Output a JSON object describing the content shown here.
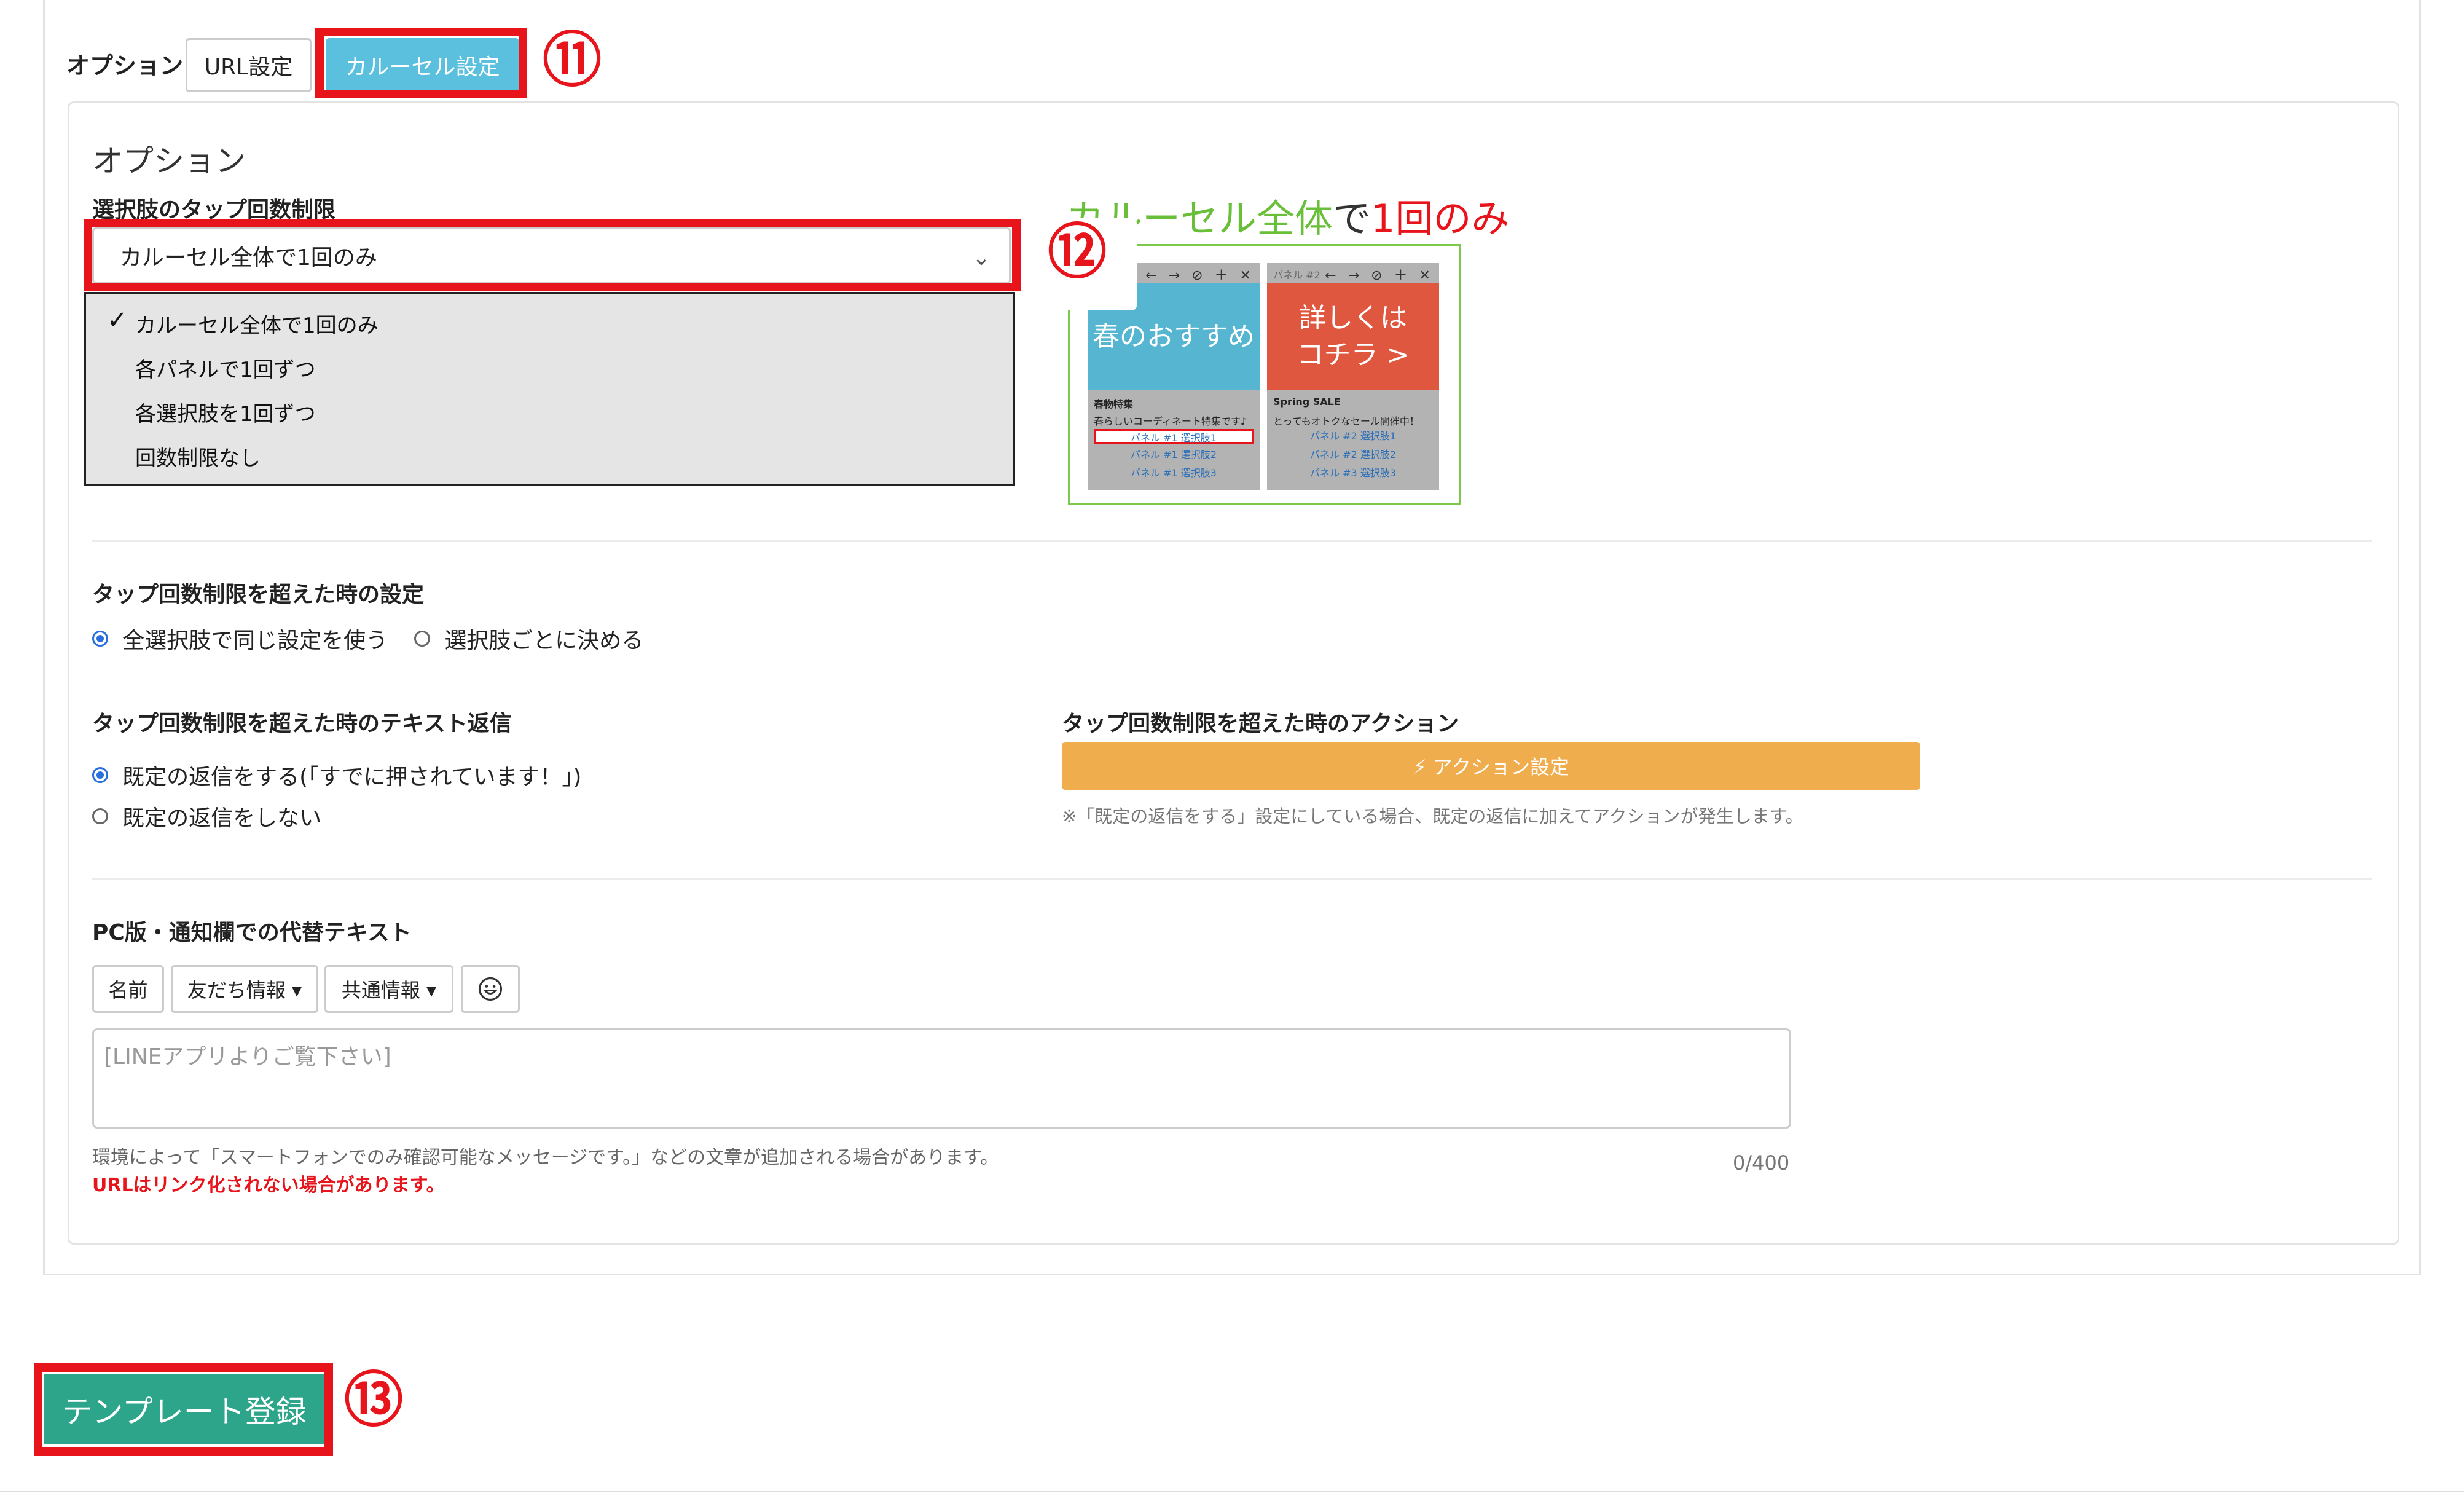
{
  "tabs": {
    "label": "オプション",
    "items": [
      "URL設定",
      "カルーセル設定"
    ],
    "active_index": 1
  },
  "callouts": [
    "⑪",
    "⑫",
    "⑬"
  ],
  "options": {
    "section_title": "オプション",
    "tap_limit": {
      "label": "選択肢のタップ回数制限",
      "selected": "カルーセル全体で1回のみ",
      "dropdown_options": [
        "カルーセル全体で1回のみ",
        "各パネルで1回ずつ",
        "各選択肢を1回ずつ",
        "回数制限なし"
      ],
      "checked_index": 0
    },
    "preview": {
      "title_green": "カルーセル全体",
      "title_mid": "で",
      "title_red": "1回のみ",
      "panels": [
        {
          "image_text": "春のおすすめ",
          "ctrl": "← → ⊘ ＋ ✕",
          "label": "",
          "heading": "春物特集",
          "desc": "春らしいコーディネート特集です♪",
          "buttons": [
            "パネル #1 選択肢1",
            "パネル #1 選択肢2",
            "パネル #1 選択肢3"
          ]
        },
        {
          "image_text": "詳しくは\nコチラ >",
          "ctrl": "← → ⊘ ＋ ✕",
          "label": "パネル #2",
          "heading": "Spring SALE",
          "desc": "とってもオトクなセール開催中！",
          "buttons": [
            "パネル #2 選択肢1",
            "パネル #2 選択肢2",
            "パネル #3 選択肢3"
          ]
        }
      ]
    },
    "over_limit_setting": {
      "label": "タップ回数制限を超えた時の設定",
      "options": [
        "全選択肢で同じ設定を使う",
        "選択肢ごとに決める"
      ],
      "selected_index": 0
    },
    "over_limit_text": {
      "label": "タップ回数制限を超えた時のテキスト返信",
      "options": [
        "既定の返信をする(「すでに押されています！」)",
        "既定の返信をしない"
      ],
      "selected_index": 0
    },
    "over_limit_action": {
      "label": "タップ回数制限を超えた時のアクション",
      "button": "⚡ アクション設定",
      "note": "※「既定の返信をする」設定にしている場合、既定の返信に加えてアクションが発生します。"
    },
    "alt_text": {
      "label": "PC版・通知欄での代替テキスト",
      "toolbar": [
        "名前",
        "友だち情報 ▾",
        "共通情報 ▾"
      ],
      "emoji_icon": "smile-icon",
      "placeholder": "[LINEアプリよりご覧下さい]",
      "help": "環境によって「スマートフォンでのみ確認可能なメッセージです。」などの文章が追加される場合があります。",
      "warning": "URLはリンク化されない場合があります。",
      "counter": "0/400"
    }
  },
  "submit": {
    "label": "テンプレート登録"
  },
  "colors": {
    "active_tab": "#5bc0de",
    "callout_red": "#e8141b",
    "action_orange": "#f0ad4e",
    "submit_green": "#2da58a",
    "preview_green": "#7cc94b",
    "radio_blue": "#2a6fdb"
  }
}
